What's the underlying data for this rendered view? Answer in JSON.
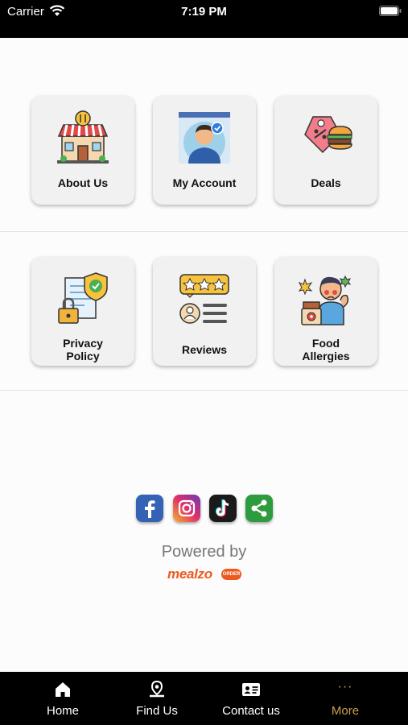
{
  "status_bar": {
    "carrier": "Carrier",
    "time": "7:19 PM"
  },
  "menu": {
    "row1": [
      {
        "label": "About Us",
        "icon": "restaurant-icon"
      },
      {
        "label": "My Account",
        "icon": "user-profile-icon"
      },
      {
        "label": "Deals",
        "icon": "burger-tag-icon"
      }
    ],
    "row2": [
      {
        "label": "Privacy Policy",
        "icon": "lock-shield-document-icon"
      },
      {
        "label": "Reviews",
        "icon": "star-review-icon"
      },
      {
        "label": "Food Allergies",
        "icon": "allergy-person-icon"
      }
    ]
  },
  "social": [
    "facebook-icon",
    "instagram-icon",
    "tiktok-icon",
    "share-icon"
  ],
  "footer": {
    "powered_by": "Powered by",
    "brand": "mealzo",
    "brand_badge": "ORDER"
  },
  "tabbar": {
    "tabs": [
      {
        "label": "Home",
        "icon": "home-icon"
      },
      {
        "label": "Find Us",
        "icon": "map-pin-icon"
      },
      {
        "label": "Contact us",
        "icon": "contact-card-icon"
      },
      {
        "label": "More",
        "icon": "more-dots-icon",
        "active": true
      }
    ],
    "active_color": "#c9a24a"
  }
}
